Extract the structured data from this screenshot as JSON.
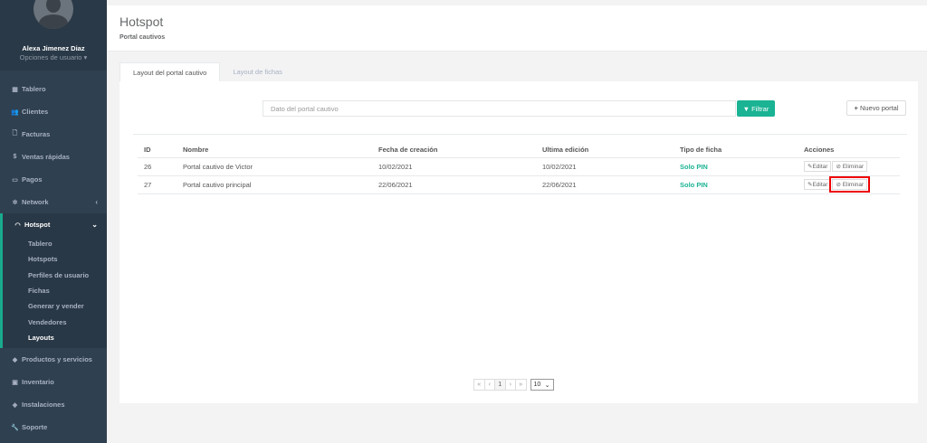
{
  "sidebar": {
    "user": {
      "name": "Alexa Jimenez Diaz",
      "options": "Opciones de usuario"
    },
    "items": [
      {
        "label": "Tablero",
        "icon": "dashboard-icon"
      },
      {
        "label": "Clientes",
        "icon": "users-icon"
      },
      {
        "label": "Facturas",
        "icon": "file-icon"
      },
      {
        "label": "Ventas rápidas",
        "icon": "dollar-icon"
      },
      {
        "label": "Pagos",
        "icon": "money-icon"
      },
      {
        "label": "Network",
        "icon": "network-icon"
      },
      {
        "label": "Hotspot",
        "icon": "wifi-icon"
      }
    ],
    "hotspot_sub": [
      "Tablero",
      "Hotspots",
      "Perfiles de usuario",
      "Fichas",
      "Generar y vender",
      "Vendedores",
      "Layouts"
    ],
    "items_bottom": [
      {
        "label": "Productos y servicios",
        "icon": "tag-icon"
      },
      {
        "label": "Inventario",
        "icon": "cubes-icon"
      },
      {
        "label": "Instalaciones",
        "icon": "gear-icon"
      },
      {
        "label": "Soporte",
        "icon": "wrench-icon"
      }
    ]
  },
  "header": {
    "title": "Hotspot",
    "subtitle": "Portal cautivos"
  },
  "tabs": [
    "Layout del portal cautivo",
    "Layout de fichas"
  ],
  "toolbar": {
    "search_placeholder": "Dato del portal cautivo",
    "filter_label": "Filtrar",
    "new_label": "Nuevo portal"
  },
  "table": {
    "headers": [
      "ID",
      "Nombre",
      "Fecha de creación",
      "Ultima edición",
      "Tipo de ficha",
      "Acciones"
    ],
    "rows": [
      {
        "id": "26",
        "name": "Portal cautivo de Victor",
        "created": "10/02/2021",
        "edited": "10/02/2021",
        "type": "Solo PIN"
      },
      {
        "id": "27",
        "name": "Portal cautivo principal",
        "created": "22/06/2021",
        "edited": "22/06/2021",
        "type": "Solo PIN"
      }
    ],
    "edit_label": "Editar",
    "delete_label": "Eliminar"
  },
  "pagination": {
    "first": "«",
    "prev": "‹",
    "page": "1",
    "next": "›",
    "last": "»",
    "page_size": "10"
  },
  "colors": {
    "sidebar": "#2f4050",
    "accent": "#1ab394",
    "highlight": "#ee0000"
  }
}
